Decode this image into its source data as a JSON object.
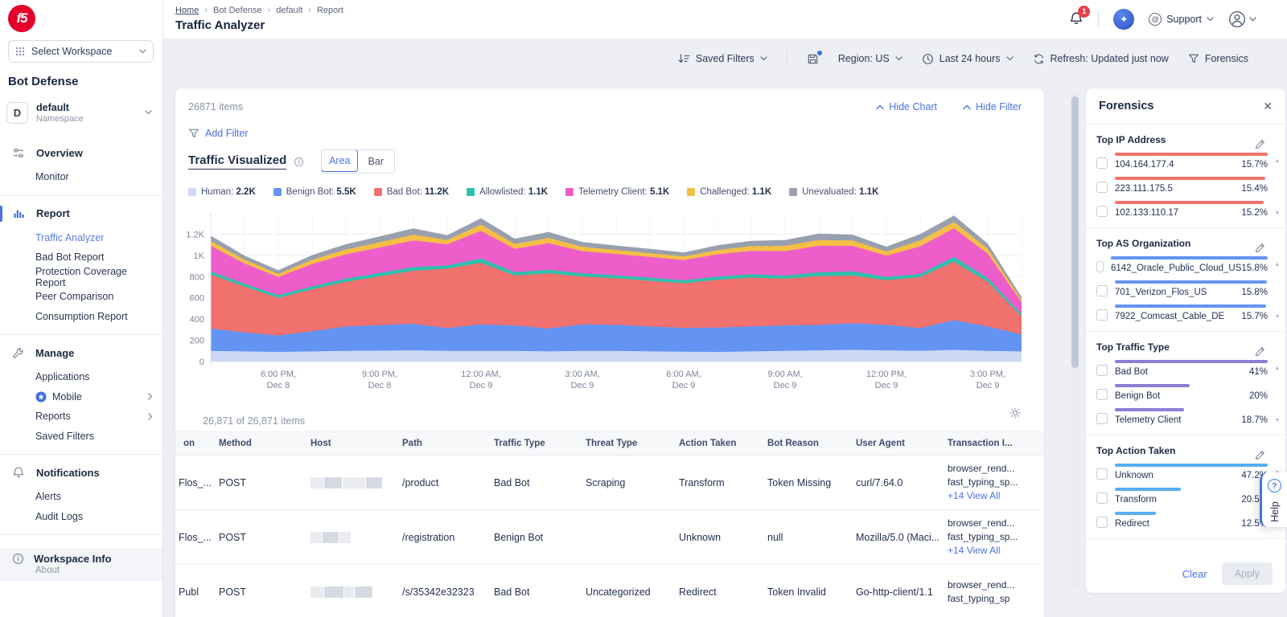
{
  "header": {
    "breadcrumb": [
      "Home",
      "Bot Defense",
      "default",
      "Report"
    ],
    "title": "Traffic Analyzer",
    "notification_badge": "1",
    "support_label": "Support"
  },
  "toolbar": {
    "saved_filters": "Saved Filters",
    "region": "Region: US",
    "time_range": "Last 24 hours",
    "refresh": "Refresh: Updated just now",
    "forensics": "Forensics"
  },
  "sidebar": {
    "workspace_selector": "Select Workspace",
    "product": "Bot Defense",
    "namespace": {
      "initial": "D",
      "name": "default",
      "type": "Namespace"
    },
    "groups": [
      {
        "icon": "overview",
        "label": "Overview",
        "active": false,
        "items": [
          {
            "label": "Monitor"
          }
        ]
      },
      {
        "icon": "report",
        "label": "Report",
        "active": true,
        "items": [
          {
            "label": "Traffic Analyzer",
            "active": true
          },
          {
            "label": "Bad Bot Report"
          },
          {
            "label": "Protection Coverage Report"
          },
          {
            "label": "Peer Comparison"
          },
          {
            "label": "Consumption Report"
          }
        ]
      },
      {
        "icon": "manage",
        "label": "Manage",
        "active": false,
        "items": [
          {
            "label": "Applications"
          },
          {
            "label": "Mobile",
            "badge": true,
            "chevron": true
          },
          {
            "label": "Reports",
            "chevron": true
          },
          {
            "label": "Saved Filters"
          }
        ]
      },
      {
        "icon": "notifications",
        "label": "Notifications",
        "active": false,
        "items": [
          {
            "label": "Alerts"
          },
          {
            "label": "Audit Logs"
          }
        ]
      }
    ],
    "workspace_info": {
      "label": "Workspace Info",
      "sub": "About"
    }
  },
  "main": {
    "items_count": "26871 items",
    "hide_chart": "Hide Chart",
    "hide_filter": "Hide Filter",
    "add_filter": "Add Filter",
    "chart_title": "Traffic Visualized",
    "view_options": [
      "Area",
      "Bar"
    ],
    "active_view": "Area",
    "table_count": "26,871 of 26,871 items"
  },
  "chart_data": {
    "type": "area",
    "stacked": true,
    "title": "Traffic Visualized",
    "ylim": [
      0,
      1400
    ],
    "yticks": [
      {
        "label": "0",
        "value": 0
      },
      {
        "label": "200",
        "value": 200
      },
      {
        "label": "400",
        "value": 400
      },
      {
        "label": "600",
        "value": 600
      },
      {
        "label": "800",
        "value": 800
      },
      {
        "label": "1K",
        "value": 1000
      },
      {
        "label": "1.2K",
        "value": 1200
      }
    ],
    "x_labels": [
      {
        "i": 2,
        "time": "6:00 PM,",
        "date": "Dec 8"
      },
      {
        "i": 5,
        "time": "9:00 PM,",
        "date": "Dec 8"
      },
      {
        "i": 8,
        "time": "12:00 AM,",
        "date": "Dec 9"
      },
      {
        "i": 11,
        "time": "3:00 AM,",
        "date": "Dec 9"
      },
      {
        "i": 14,
        "time": "6:00 AM,",
        "date": "Dec 9"
      },
      {
        "i": 17,
        "time": "9:00 AM,",
        "date": "Dec 9"
      },
      {
        "i": 20,
        "time": "12:00 PM,",
        "date": "Dec 9"
      },
      {
        "i": 23,
        "time": "3:00 PM,",
        "date": "Dec 9"
      }
    ],
    "series": [
      {
        "name": "Human",
        "value": "2.2K",
        "color": "#ccd8f4",
        "values": [
          100,
          95,
          90,
          95,
          100,
          102,
          105,
          100,
          100,
          100,
          95,
          100,
          100,
          95,
          92,
          90,
          95,
          100,
          105,
          110,
          105,
          100,
          110,
          100,
          95
        ]
      },
      {
        "name": "Benign Bot",
        "value": "5.5K",
        "color": "#6394f3",
        "values": [
          210,
          180,
          155,
          190,
          230,
          240,
          250,
          215,
          250,
          240,
          215,
          250,
          245,
          235,
          225,
          230,
          235,
          240,
          240,
          250,
          240,
          215,
          280,
          230,
          160
        ]
      },
      {
        "name": "Bad Bot",
        "value": "11.2K",
        "color": "#f0716e",
        "values": [
          510,
          430,
          355,
          395,
          420,
          460,
          500,
          560,
          580,
          470,
          520,
          450,
          440,
          430,
          420,
          450,
          460,
          440,
          460,
          450,
          420,
          480,
          550,
          420,
          170
        ]
      },
      {
        "name": "Allowlisted",
        "value": "1.1K",
        "color": "#2fc0ad",
        "values": [
          30,
          28,
          25,
          28,
          30,
          32,
          35,
          30,
          40,
          32,
          35,
          30,
          28,
          30,
          28,
          30,
          32,
          30,
          35,
          40,
          32,
          30,
          45,
          35,
          22
        ]
      },
      {
        "name": "Telemetry Client",
        "value": "5.1K",
        "color": "#ee5ecb",
        "values": [
          240,
          190,
          170,
          210,
          230,
          240,
          250,
          200,
          260,
          220,
          250,
          210,
          200,
          195,
          190,
          210,
          220,
          230,
          250,
          240,
          200,
          260,
          270,
          230,
          110
        ]
      },
      {
        "name": "Challenged",
        "value": "1.1K",
        "color": "#f5bf45",
        "values": [
          45,
          35,
          30,
          40,
          45,
          50,
          55,
          40,
          60,
          45,
          50,
          40,
          38,
          36,
          35,
          40,
          45,
          50,
          55,
          50,
          40,
          55,
          60,
          45,
          22
        ]
      },
      {
        "name": "Unevaluated",
        "value": "1.1K",
        "color": "#98a0af",
        "values": [
          50,
          40,
          35,
          45,
          50,
          55,
          60,
          45,
          60,
          50,
          55,
          45,
          42,
          40,
          38,
          45,
          50,
          55,
          60,
          55,
          45,
          60,
          60,
          50,
          28
        ]
      }
    ]
  },
  "table": {
    "columns": [
      "on",
      "Method",
      "Host",
      "Path",
      "Traffic Type",
      "Threat Type",
      "Action Taken",
      "Bot Reason",
      "User Agent",
      "Transaction I..."
    ],
    "rows": [
      {
        "org": "Flos_...",
        "method": "POST",
        "host_redacted": true,
        "path": "/product",
        "traffic_type": "Bad Bot",
        "threat_type": "Scraping",
        "action_taken": "Transform",
        "bot_reason": "Token Missing",
        "user_agent": "curl/7.64.0",
        "transaction_lines": [
          "browser_rend...",
          "fast_typing_sp..."
        ],
        "view_all": "+14 View All"
      },
      {
        "org": "Flos_...",
        "method": "POST",
        "host_redacted": true,
        "path": "/registration",
        "traffic_type": "Benign Bot",
        "threat_type": "",
        "action_taken": "Unknown",
        "bot_reason": "null",
        "user_agent": "Mozilla/5.0 (Maci...",
        "transaction_lines": [
          "browser_rend...",
          "fast_typing_sp..."
        ],
        "view_all": "+14 View All"
      },
      {
        "org": "Publ",
        "method": "POST",
        "host_redacted": true,
        "path": "/s/35342e32323",
        "traffic_type": "Bad Bot",
        "threat_type": "Uncategorized",
        "action_taken": "Redirect",
        "bot_reason": "Token Invalid",
        "user_agent": "Go-http-client/1.1",
        "transaction_lines": [
          "browser_rend...",
          "fast_typing_sp"
        ],
        "view_all": ""
      }
    ]
  },
  "forensics": {
    "title": "Forensics",
    "sections": [
      {
        "title": "Top IP Address",
        "bar_color": "#f0716e",
        "items": [
          {
            "label": "104.164.177.4",
            "value": "15.7%",
            "bar": 1
          },
          {
            "label": "223.111.175.5",
            "value": "15.4%",
            "bar": 0.985
          },
          {
            "label": "102.133.110.17",
            "value": "15.2%",
            "bar": 0.975
          }
        ]
      },
      {
        "title": "Top AS Organization",
        "bar_color": "#6394f3",
        "items": [
          {
            "label": "6142_Oracle_Public_Cloud_US",
            "value": "15.8%",
            "bar": 1
          },
          {
            "label": "701_Verizon_Flos_US",
            "value": "15.8%",
            "bar": 0.995
          },
          {
            "label": "7922_Comcast_Cable_DE",
            "value": "15.7%",
            "bar": 0.99
          }
        ]
      },
      {
        "title": "Top Traffic Type",
        "bar_color": "#8b7ed6",
        "items": [
          {
            "label": "Bad Bot",
            "value": "41%",
            "bar": 1
          },
          {
            "label": "Benign Bot",
            "value": "20%",
            "bar": 0.49
          },
          {
            "label": "Telemetry Client",
            "value": "18.7%",
            "bar": 0.455
          }
        ]
      },
      {
        "title": "Top Action Taken",
        "bar_color": "#55aef2",
        "items": [
          {
            "label": "Unknown",
            "value": "47.2%",
            "bar": 1
          },
          {
            "label": "Transform",
            "value": "20.5%",
            "bar": 0.43
          },
          {
            "label": "Redirect",
            "value": "12.5%",
            "bar": 0.27
          }
        ]
      }
    ],
    "clear_label": "Clear",
    "apply_label": "Apply"
  },
  "help_tab": {
    "label": "Help"
  },
  "colors": {
    "accent": "#4a72e0",
    "brand_red": "#e4002b",
    "badge_red": "#e8414d"
  }
}
